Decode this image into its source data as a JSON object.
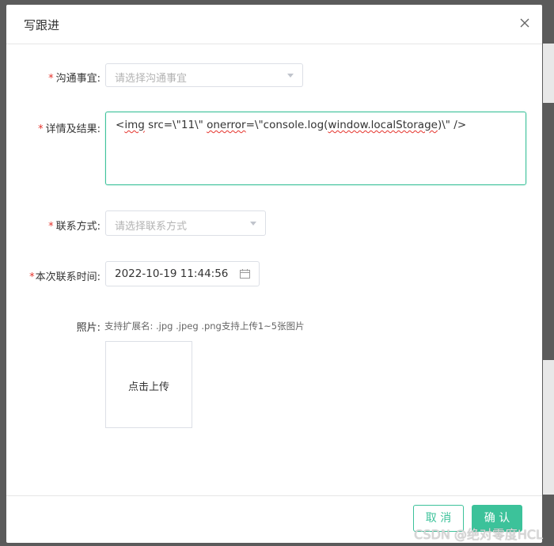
{
  "dialog": {
    "title": "写跟进",
    "close_label": "×"
  },
  "form": {
    "matter": {
      "required": "*",
      "label": "沟通事宜:",
      "placeholder": "请选择沟通事宜"
    },
    "details": {
      "required": "*",
      "label": "详情及结果:",
      "value_parts": [
        "<",
        "img",
        " src=\\\"11\\\" ",
        "onerror",
        "=\\\"console.log(",
        "window.localStorage",
        ")\\\" />"
      ]
    },
    "contact_method": {
      "required": "*",
      "label": "联系方式:",
      "placeholder": "请选择联系方式"
    },
    "contact_time": {
      "required": "*",
      "label": "本次联系时间:",
      "value": "2022-10-19 11:44:56"
    },
    "photos": {
      "label": "照片:",
      "hint": "支持扩展名: .jpg .jpeg .png支持上传1~5张图片",
      "upload_label": "点击上传"
    }
  },
  "footer": {
    "cancel_label": "取 消",
    "confirm_label": "确 认"
  },
  "watermark": "CSDN @绝对零度HCL",
  "colors": {
    "accent": "#3cc29a",
    "required": "#e5332c",
    "border": "#dcdfe6",
    "placeholder": "#b3b3b3"
  }
}
